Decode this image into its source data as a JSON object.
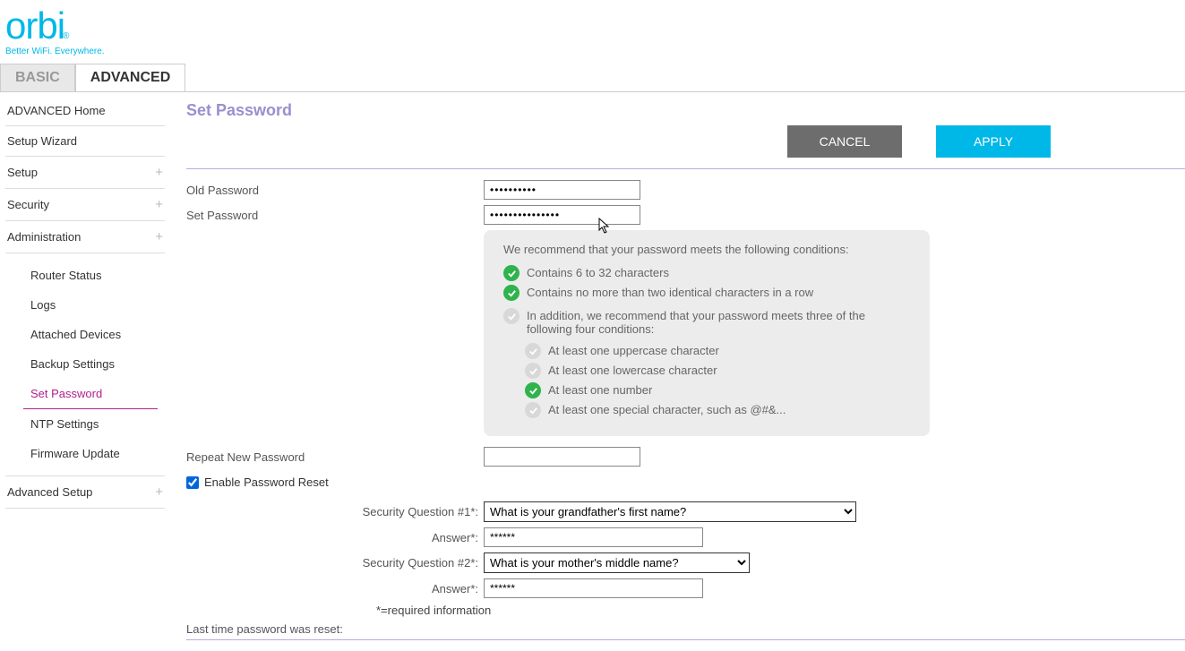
{
  "logo": {
    "brand": "orbi",
    "tagline": "Better WiFi. Everywhere."
  },
  "tabs": {
    "basic": "BASIC",
    "advanced": "ADVANCED"
  },
  "nav": {
    "advanced_home": "ADVANCED Home",
    "setup_wizard": "Setup Wizard",
    "setup": "Setup",
    "security": "Security",
    "administration": "Administration",
    "admin_sub": {
      "router_status": "Router Status",
      "logs": "Logs",
      "attached_devices": "Attached Devices",
      "backup_settings": "Backup Settings",
      "set_password": "Set Password",
      "ntp_settings": "NTP Settings",
      "firmware_update": "Firmware Update"
    },
    "advanced_setup": "Advanced Setup"
  },
  "page": {
    "title": "Set Password",
    "cancel": "CANCEL",
    "apply": "APPLY",
    "old_password_label": "Old Password",
    "old_password_value": "●●●●●●●●●●",
    "set_password_label": "Set Password",
    "set_password_value": "●●●●●●●●●●●●●●●",
    "hint_intro": "We recommend that your password meets the following conditions:",
    "cond1": "Contains 6 to 32 characters",
    "cond2": "Contains no more than two identical characters in a row",
    "sub_intro": "In addition, we recommend that your password meets three of the following four conditions:",
    "cond3": "At least one uppercase character",
    "cond4": "At least one lowercase character",
    "cond5": "At least one number",
    "cond6": "At least one special character, such as @#&...",
    "repeat_label": "Repeat New Password",
    "repeat_value": "",
    "enable_reset": "Enable Password Reset",
    "sq1_label": "Security Question #1*:",
    "sq1_value": "What is your grandfather's first name?",
    "answer1_label": "Answer*:",
    "answer1_value": "******",
    "sq2_label": "Security Question #2*:",
    "sq2_value": "What is your mother's middle name?",
    "answer2_label": "Answer*:",
    "answer2_value": "******",
    "req_note": "*=required information",
    "last_reset": "Last time password was reset:"
  }
}
